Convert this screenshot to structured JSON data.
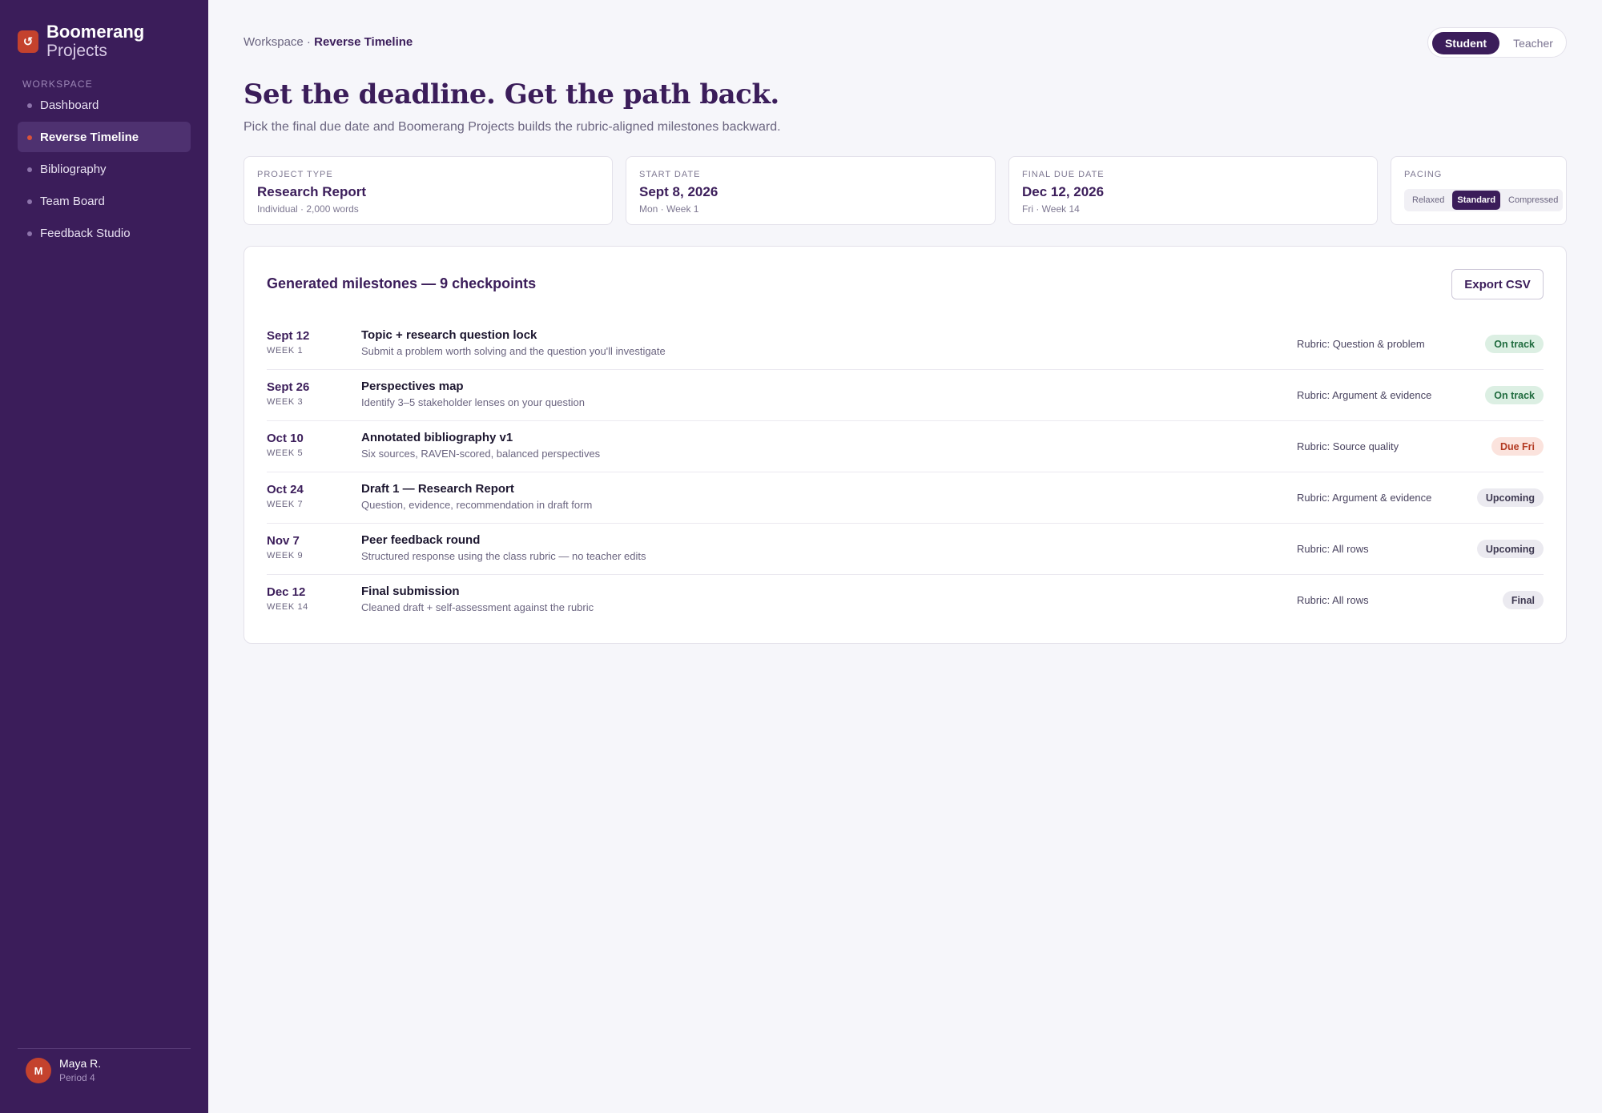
{
  "app": {
    "logo_glyph": "↺",
    "name": "Boomerang",
    "name_sub": "Projects"
  },
  "sidebar": {
    "section_label": "WORKSPACE",
    "items": [
      {
        "label": "Dashboard",
        "active": false
      },
      {
        "label": "Reverse Timeline",
        "active": true
      },
      {
        "label": "Bibliography",
        "active": false
      },
      {
        "label": "Team Board",
        "active": false
      },
      {
        "label": "Feedback Studio",
        "active": false
      }
    ],
    "user": {
      "initial": "M",
      "name": "Maya R.",
      "period": "Period 4"
    }
  },
  "header": {
    "breadcrumb_root": "Workspace",
    "breadcrumb_sep": " · ",
    "breadcrumb_current": "Reverse Timeline",
    "roles": {
      "student": "Student",
      "teacher": "Teacher",
      "selected": "Student"
    }
  },
  "hero": {
    "title": "Set the deadline. Get the path back.",
    "subtitle": "Pick the final due date and Boomerang Projects builds the rubric-aligned milestones backward."
  },
  "settings": {
    "project_type": {
      "label": "PROJECT TYPE",
      "value": "Research Report",
      "meta": "Individual · 2,000 words"
    },
    "start_date": {
      "label": "START DATE",
      "value": "Sept 8, 2026",
      "meta": "Mon · Week 1"
    },
    "due_date": {
      "label": "FINAL DUE DATE",
      "value": "Dec 12, 2026",
      "meta": "Fri · Week 14"
    },
    "pacing": {
      "label": "PACING",
      "options": [
        "Relaxed",
        "Standard",
        "Compressed"
      ],
      "selected": "Standard"
    }
  },
  "milestones": {
    "title": "Generated milestones — 9 checkpoints",
    "export_label": "Export CSV",
    "rows": [
      {
        "date": "Sept 12",
        "week": "WEEK 1",
        "title": "Topic + research question lock",
        "desc": "Submit a problem worth solving and the question you'll investigate",
        "rubric": "Rubric: Question & problem",
        "status": "On track",
        "status_kind": "ontrack"
      },
      {
        "date": "Sept 26",
        "week": "WEEK 3",
        "title": "Perspectives map",
        "desc": "Identify 3–5 stakeholder lenses on your question",
        "rubric": "Rubric: Argument & evidence",
        "status": "On track",
        "status_kind": "ontrack"
      },
      {
        "date": "Oct 10",
        "week": "WEEK 5",
        "title": "Annotated bibliography v1",
        "desc": "Six sources, RAVEN-scored, balanced perspectives",
        "rubric": "Rubric: Source quality",
        "status": "Due Fri",
        "status_kind": "due"
      },
      {
        "date": "Oct 24",
        "week": "WEEK 7",
        "title": "Draft 1 — Research Report",
        "desc": "Question, evidence, recommendation in draft form",
        "rubric": "Rubric: Argument & evidence",
        "status": "Upcoming",
        "status_kind": "upcoming"
      },
      {
        "date": "Nov 7",
        "week": "WEEK 9",
        "title": "Peer feedback round",
        "desc": "Structured response using the class rubric — no teacher edits",
        "rubric": "Rubric: All rows",
        "status": "Upcoming",
        "status_kind": "upcoming"
      },
      {
        "date": "Dec 12",
        "week": "WEEK 14",
        "title": "Final submission",
        "desc": "Cleaned draft + self-assessment against the rubric",
        "rubric": "Rubric: All rows",
        "status": "Final",
        "status_kind": "final"
      }
    ]
  },
  "colors": {
    "sidebar_bg": "#3b1d5a",
    "accent": "#c4422d",
    "ontrack": "#1f6b3e",
    "due": "#b33a22"
  }
}
